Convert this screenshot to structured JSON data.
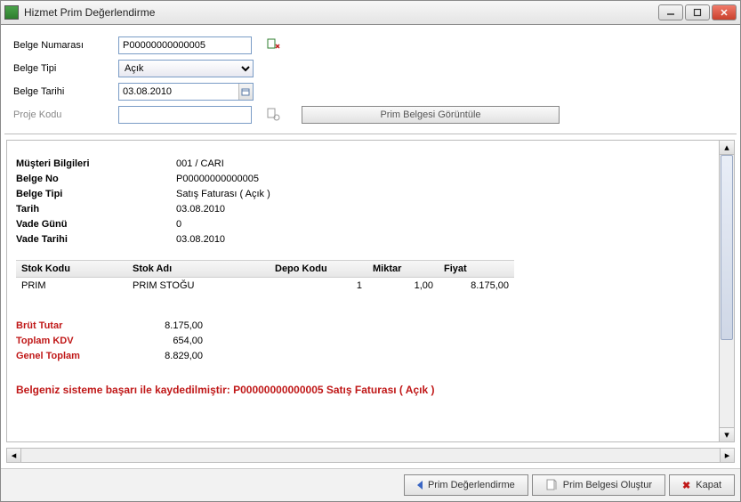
{
  "window": {
    "title": "Hizmet Prim Değerlendirme"
  },
  "form": {
    "doc_number_label": "Belge Numarası",
    "doc_number_value": "P00000000000005",
    "doc_type_label": "Belge Tipi",
    "doc_type_value": "Açık",
    "doc_date_label": "Belge Tarihi",
    "doc_date_value": "03.08.2010",
    "project_code_label": "Proje Kodu",
    "project_code_value": "",
    "view_doc_button": "Prim Belgesi Görüntüle"
  },
  "info": {
    "customer_label": "Müşteri Bilgileri",
    "customer_value": "001 / CARI",
    "doc_no_label": "Belge No",
    "doc_no_value": "P00000000000005",
    "doc_type_label": "Belge Tipi",
    "doc_type_value": "Satış Faturası ( Açık )",
    "date_label": "Tarih",
    "date_value": "03.08.2010",
    "due_day_label": "Vade Günü",
    "due_day_value": "0",
    "due_date_label": "Vade Tarihi",
    "due_date_value": "03.08.2010"
  },
  "grid": {
    "headers": {
      "stock_code": "Stok Kodu",
      "stock_name": "Stok Adı",
      "warehouse": "Depo Kodu",
      "qty": "Miktar",
      "price": "Fiyat"
    },
    "row": {
      "stock_code": "PRIM",
      "stock_name": "PRIM STOĞU",
      "warehouse": "1",
      "qty": "1,00",
      "price": "8.175,00"
    }
  },
  "totals": {
    "gross_label": "Brüt Tutar",
    "gross_value": "8.175,00",
    "vat_label": "Toplam KDV",
    "vat_value": "654,00",
    "grand_label": "Genel Toplam",
    "grand_value": "8.829,00"
  },
  "success_message": "Belgeniz sisteme başarı ile kaydedilmiştir: P00000000000005 Satış Faturası ( Açık )",
  "buttons": {
    "prim_deger": "Prim Değerlendirme",
    "prim_olustur": "Prim Belgesi Oluştur",
    "kapat": "Kapat"
  }
}
